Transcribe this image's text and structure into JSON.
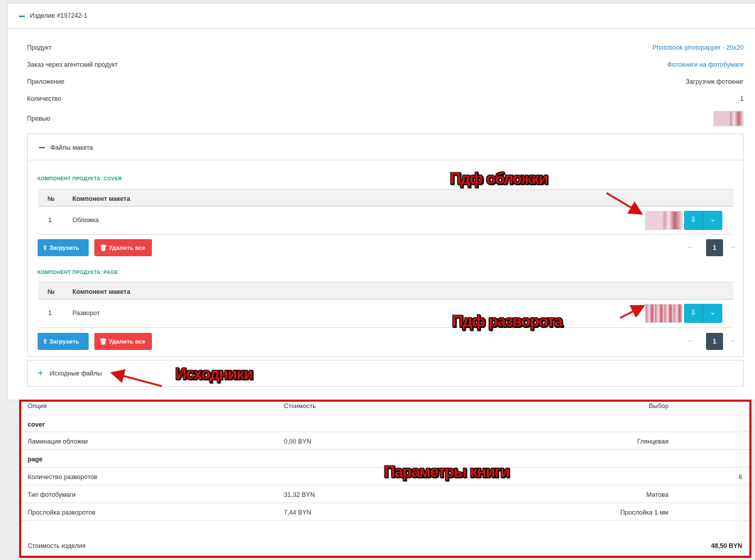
{
  "item": {
    "title": "Изделие #197242-1",
    "fields": [
      {
        "label": "Продукт",
        "value": "Photobook photopapper - 20x20"
      },
      {
        "label": "Заказ через агентский продукт",
        "value": "Фотокниги на фотобумаге"
      },
      {
        "label": "Приложение",
        "value": "Загрузчик фотокниг"
      },
      {
        "label": "Количество",
        "value": "1"
      },
      {
        "label": "Превью",
        "value": ""
      }
    ]
  },
  "files": {
    "title": "Файлы макета",
    "sections": [
      {
        "component_label": "КОМПОНЕНТ ПРОДУКТА: COVER",
        "columns": [
          "№",
          "Компонент макета"
        ],
        "rows": [
          {
            "num": "1",
            "name": "Обложка"
          }
        ],
        "upload_label": "Загрузить",
        "delete_label": "Удалить все",
        "pager": {
          "prev": "←",
          "page": "1",
          "next": "→"
        }
      },
      {
        "component_label": "КОМПОНЕНТ ПРОДУКТА: PAGE",
        "columns": [
          "№",
          "Компонент макета"
        ],
        "rows": [
          {
            "num": "1",
            "name": "Разворот"
          }
        ],
        "upload_label": "Загрузить",
        "delete_label": "Удалить все",
        "pager": {
          "prev": "←",
          "page": "1",
          "next": "→"
        }
      }
    ]
  },
  "source_files": {
    "title": "Исходные файлы"
  },
  "options": {
    "columns": [
      "Опция",
      "Стоимость",
      "Выбор"
    ],
    "groups": [
      {
        "name": "cover",
        "rows": [
          {
            "option": "Ламинация обложки",
            "cost": "0,00 BYN",
            "choice": "Глянцевая",
            "extra": ""
          }
        ]
      },
      {
        "name": "page",
        "rows": [
          {
            "option": "Количество разворотов",
            "cost": "",
            "choice": "",
            "extra": "6"
          },
          {
            "option": "Тип фотобумаги",
            "cost": "31,32 BYN",
            "choice": "Матова",
            "extra": ""
          },
          {
            "option": "Прослойка разворотов",
            "cost": "7,44 BYN",
            "choice": "Прослойка 1 мм",
            "extra": ""
          }
        ]
      }
    ],
    "total_label": "Стоимость изделия",
    "total_value": "48,50 BYN"
  },
  "annotations": {
    "cover_pdf": "Пдф обложки",
    "spread_pdf": "Пдф разворота",
    "sources": "Исходники",
    "book_params": "Параметры книги"
  },
  "colors": {
    "link": "#1f83d4",
    "accent_green": "#1f9a80",
    "annotation_red": "#d41111",
    "upload_blue": "#2b98dc",
    "delete_red": "#ef4242",
    "download_cyan": "#12b4d6"
  },
  "icons": [
    "minus-icon",
    "plus-icon",
    "download-icon",
    "chevron-down-icon",
    "upload-icon",
    "trash-icon"
  ]
}
